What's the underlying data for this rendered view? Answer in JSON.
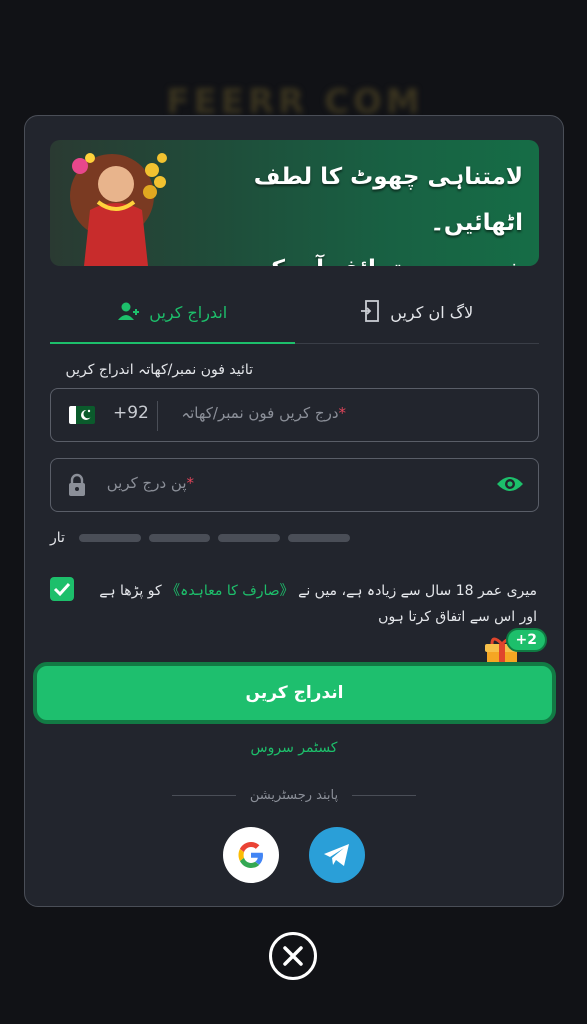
{
  "backdrop": {
    "title": "FEERR COM"
  },
  "banner": {
    "line1": "لامتناہی چھوٹ کا لطف اٹھائیں۔",
    "line2": "خوبصورت تحائف آپ کے منتظر ہیں۔"
  },
  "tabs": [
    {
      "label": "لاگ ان کریں",
      "icon": "login-door-icon",
      "active": false
    },
    {
      "label": "اندراج کریں",
      "icon": "add-user-icon",
      "active": true
    }
  ],
  "phone": {
    "label": "تائید فون نمبر/کھاتہ اندراج کریں",
    "country_code": "+92",
    "flag": "pakistan-flag-icon",
    "placeholder": "درج کریں فون نمبر/کھاتہ",
    "required_mark": "*"
  },
  "pin": {
    "placeholder": "پن درج کریں",
    "required_mark": "*"
  },
  "strength": {
    "label": "تار",
    "segments": 4
  },
  "terms": {
    "checked": true,
    "prefix": "میری عمر 18 سال سے زیادہ ہے، میں نے",
    "link": "《صارف کا معاہدہ》",
    "suffix": "کو پڑھا ہے اور اس سے اتفاق کرتا ہوں"
  },
  "bonus": {
    "badge": "+2"
  },
  "submit_label": "اندراج کریں",
  "support_label": "کسٹمر سروس",
  "social": {
    "label": "پابند رجسٹریشن"
  },
  "colors": {
    "accent": "#1dbf6b",
    "panel": "#22252d",
    "background": "#111216",
    "telegram": "#2a9fd8"
  }
}
